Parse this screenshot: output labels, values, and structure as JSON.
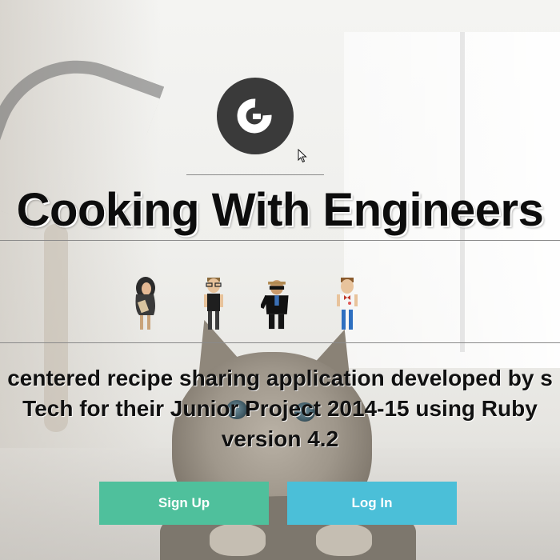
{
  "header": {
    "title": "Cooking With Engineers"
  },
  "description": {
    "lines": [
      "centered recipe sharing application developed by s",
      "Tech for their Junior Project 2014-15 using Ruby",
      "version 4.2"
    ]
  },
  "actions": {
    "signup_label": "Sign Up",
    "login_label": "Log In"
  },
  "team": {
    "avatars": [
      "person-in-hijab-icon",
      "person-with-glasses-icon",
      "person-in-suit-with-sunglasses-icon",
      "person-with-bow-tie-icon"
    ]
  },
  "colors": {
    "signup_button": "#4fc09c",
    "login_button": "#4bbfd8",
    "logo": "#3a3a3a"
  }
}
